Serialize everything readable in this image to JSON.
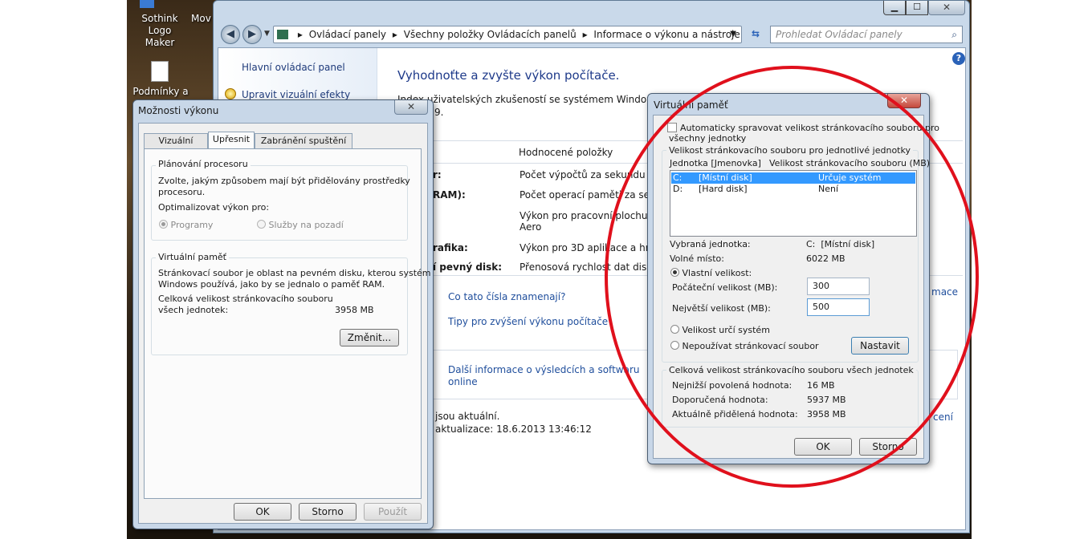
{
  "desktop": {
    "icons": [
      {
        "label_line1": "Sothink Logo",
        "label_line2": "Maker"
      },
      {
        "label_line1": "Mov",
        "label_line2": ""
      },
      {
        "label_line1": "Podmínky a",
        "label_line2": ""
      }
    ]
  },
  "control_panel": {
    "breadcrumb": [
      "Ovládací panely",
      "Všechny položky Ovládacích panelů",
      "Informace o výkonu a nástroje"
    ],
    "search_placeholder": "Prohledat Ovládací panely",
    "sidebar": {
      "home_link": "Hlavní ovládací panel",
      "visual_effects_link": "Upravit vizuální efekty"
    },
    "heading": "Vyhodnoťte a zvyšte výkon počítače.",
    "intro_text": "Index uživatelských zkušeností se systémem Windows vyho",
    "intro_text2": "9.",
    "table_header": "Hodnocené položky",
    "rows": [
      {
        "component": "r:",
        "item": "Počet výpočtů za sekundu"
      },
      {
        "component": "RAM):",
        "item": "Počet operací paměti za sekun"
      },
      {
        "component": "",
        "item": "Výkon pro pracovní plochu Wi"
      },
      {
        "component": "",
        "item": "Aero"
      },
      {
        "component": "rafika:",
        "item": "Výkon pro 3D aplikace a hry"
      },
      {
        "component": "í pevný disk:",
        "item": "Přenosová rychlost dat disku"
      }
    ],
    "links": {
      "what_numbers_mean": "Co tato čísla znamenají?",
      "tips": "Tipy pro zvýšení výkonu počítače",
      "more_info_line1": "Další informace o výsledcích a softwaru",
      "more_info_line2": "online",
      "right_link1": "mace",
      "right_link2": "cení"
    },
    "status_line1": "jsou aktuální.",
    "status_line2": "aktualizace: 18.6.2013 13:46:12"
  },
  "perf_dialog": {
    "title": "Možnosti výkonu",
    "tabs": [
      "Vizuální efekty",
      "Upřesnit",
      "Zabránění spuštění dat"
    ],
    "active_tab": "Upřesnit",
    "cpu_group": {
      "title": "Plánování procesoru",
      "desc_line1": "Zvolte, jakým způsobem mají být přidělovány prostředky",
      "desc_line2": "procesoru.",
      "optimize_label": "Optimalizovat výkon pro:",
      "option_programs": "Programy",
      "option_services": "Služby na pozadí"
    },
    "vm_group": {
      "title": "Virtuální paměť",
      "desc_line1": "Stránkovací soubor je oblast na pevném disku, kterou systém",
      "desc_line2": "Windows používá, jako by se jednalo o paměť RAM.",
      "total_line1": "Celková velikost stránkovacího souboru",
      "total_line2": "všech jednotek:",
      "total_value": "3958 MB",
      "change_button": "Změnit..."
    },
    "buttons": {
      "ok": "OK",
      "cancel": "Storno",
      "apply": "Použít"
    }
  },
  "vm_dialog": {
    "title": "Virtuální paměť",
    "auto_manage_line1": "Automaticky spravovat velikost stránkovacího souboru pro",
    "auto_manage_line2": "všechny jednotky",
    "drives_group_title": "Velikost stránkovacího souboru pro jednotlivé jednotky",
    "col_drive": "Jednotka [Jmenovka]",
    "col_size": "Velikost stránkovacího souboru (MB)",
    "drives": [
      {
        "letter": "C:",
        "label": "[Místní disk]",
        "size": "Určuje systém",
        "selected": true
      },
      {
        "letter": "D:",
        "label": "[Hard disk]",
        "size": "Není",
        "selected": false
      }
    ],
    "selected_drive_label": "Vybraná jednotka:",
    "selected_drive_value": "C:  [Místní disk]",
    "free_space_label": "Volné místo:",
    "free_space_value": "6022 MB",
    "custom_size_label": "Vlastní velikost:",
    "initial_size_label": "Počáteční velikost (MB):",
    "initial_size_value": "300",
    "max_size_label": "Největší velikost (MB):",
    "max_size_value": "500",
    "system_managed_label": "Velikost určí systém",
    "no_paging_label": "Nepoužívat stránkovací soubor",
    "set_button": "Nastavit",
    "totals_group_title": "Celková velikost stránkovacího souboru všech jednotek",
    "min_allowed_label": "Nejnižší povolená hodnota:",
    "min_allowed_value": "16 MB",
    "recommended_label": "Doporučená hodnota:",
    "recommended_value": "5937 MB",
    "current_label": "Aktuálně přidělená hodnota:",
    "current_value": "3958 MB",
    "ok_button": "OK",
    "cancel_button": "Storno"
  },
  "colors": {
    "annotation_circle": "#e0101c",
    "link_blue": "#1f4e9c",
    "selection_blue": "#3399ff"
  }
}
